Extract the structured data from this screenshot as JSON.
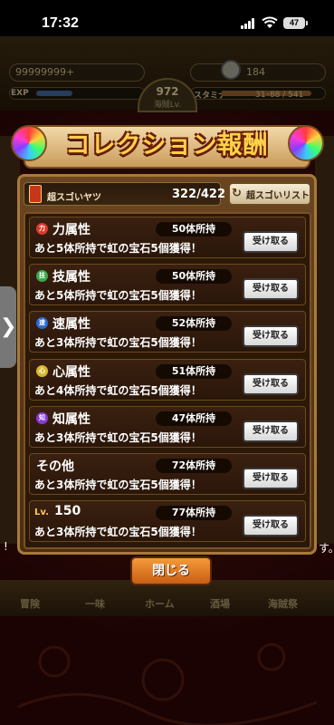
{
  "status_bar": {
    "time": "17:32",
    "battery": "47"
  },
  "header": {
    "currency": "99999999+",
    "bombs": "184",
    "exp_label": "EXP",
    "level": "972",
    "level_caption": "海賊Lv.",
    "stamina_label": "スタミナ",
    "stamina_value": "31･88 / 541"
  },
  "background": {
    "nav_items": [
      "冒険",
      "一味",
      "ホーム",
      "酒場",
      "海賊祭"
    ],
    "edge_right": "す。",
    "edge_left": "!"
  },
  "modal": {
    "title": "コレクション報酬",
    "collection_label": "超スゴいヤツ",
    "collection_count": "322/422",
    "list_button_label": "超スゴいリスト",
    "close_label": "閉じる",
    "claim_label": "受け取る",
    "rows": [
      {
        "icon": "力",
        "icon_color": "#d83a2a",
        "name": "力属性",
        "owned": "50体所持",
        "desc": "あと5体所持で虹の宝石5個獲得！"
      },
      {
        "icon": "技",
        "icon_color": "#3aa84a",
        "name": "技属性",
        "owned": "50体所持",
        "desc": "あと5体所持で虹の宝石5個獲得！"
      },
      {
        "icon": "速",
        "icon_color": "#2a6ad8",
        "name": "速属性",
        "owned": "52体所持",
        "desc": "あと3体所持で虹の宝石5個獲得！"
      },
      {
        "icon": "心",
        "icon_color": "#d8b82a",
        "name": "心属性",
        "owned": "51体所持",
        "desc": "あと4体所持で虹の宝石5個獲得！"
      },
      {
        "icon": "知",
        "icon_color": "#8a3ad8",
        "name": "知属性",
        "owned": "47体所持",
        "desc": "あと3体所持で虹の宝石5個獲得！"
      },
      {
        "icon": "",
        "icon_color": "",
        "name": "その他",
        "owned": "72体所持",
        "desc": "あと3体所持で虹の宝石5個獲得！"
      },
      {
        "icon": "Lv.",
        "icon_color": "",
        "name": "150",
        "owned": "77体所持",
        "desc": "あと3体所持で虹の宝石5個獲得！"
      }
    ]
  }
}
